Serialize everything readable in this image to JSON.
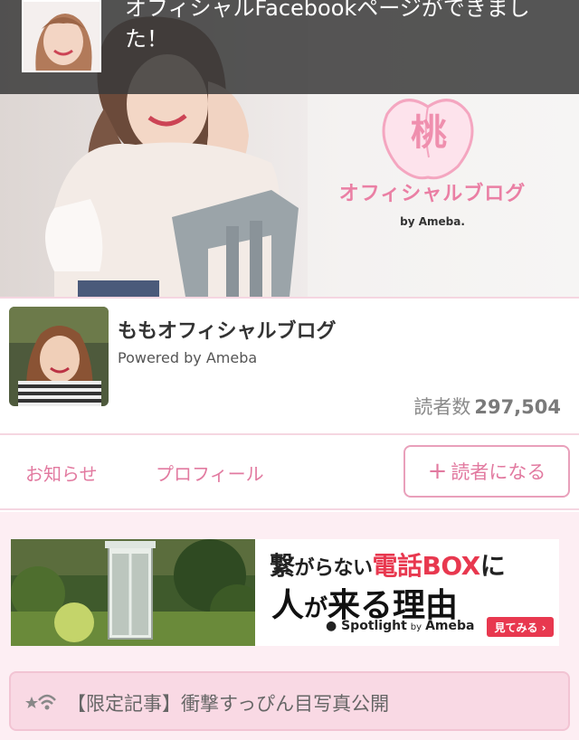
{
  "notification": {
    "text": "オフィシャルFacebookページができました！",
    "thumb_icon": "avatar-thumbnail"
  },
  "header": {
    "logo_char": "桃",
    "logo_text": "オフィシャルブログ",
    "logo_by": "by Ameba."
  },
  "profile": {
    "title": "ももオフィシャルブログ",
    "powered": "Powered by Ameba",
    "readers_label": "読者数",
    "readers_count": "297,504"
  },
  "nav": {
    "news": "お知らせ",
    "profile": "プロフィール",
    "follow_plus": "+",
    "follow_label": "読者になる"
  },
  "ad": {
    "line1_a": "繋",
    "line1_b": "がらない",
    "line1_c": "電話BOX",
    "line1_d": "に",
    "line2_a": "人",
    "line2_b": "が",
    "line2_c": "来る理由",
    "brand": "Spotlight",
    "brand_by": "by",
    "brand_ameba": "Ameba",
    "cta": "見てみる ›"
  },
  "limited": {
    "icon": "wifi-star-icon",
    "text": "【限定記事】衝撃すっぴん目写真公開"
  },
  "colors": {
    "pink_accent": "#e27aa0",
    "pink_bg": "#fdeef3",
    "red_cta": "#e8384f"
  }
}
